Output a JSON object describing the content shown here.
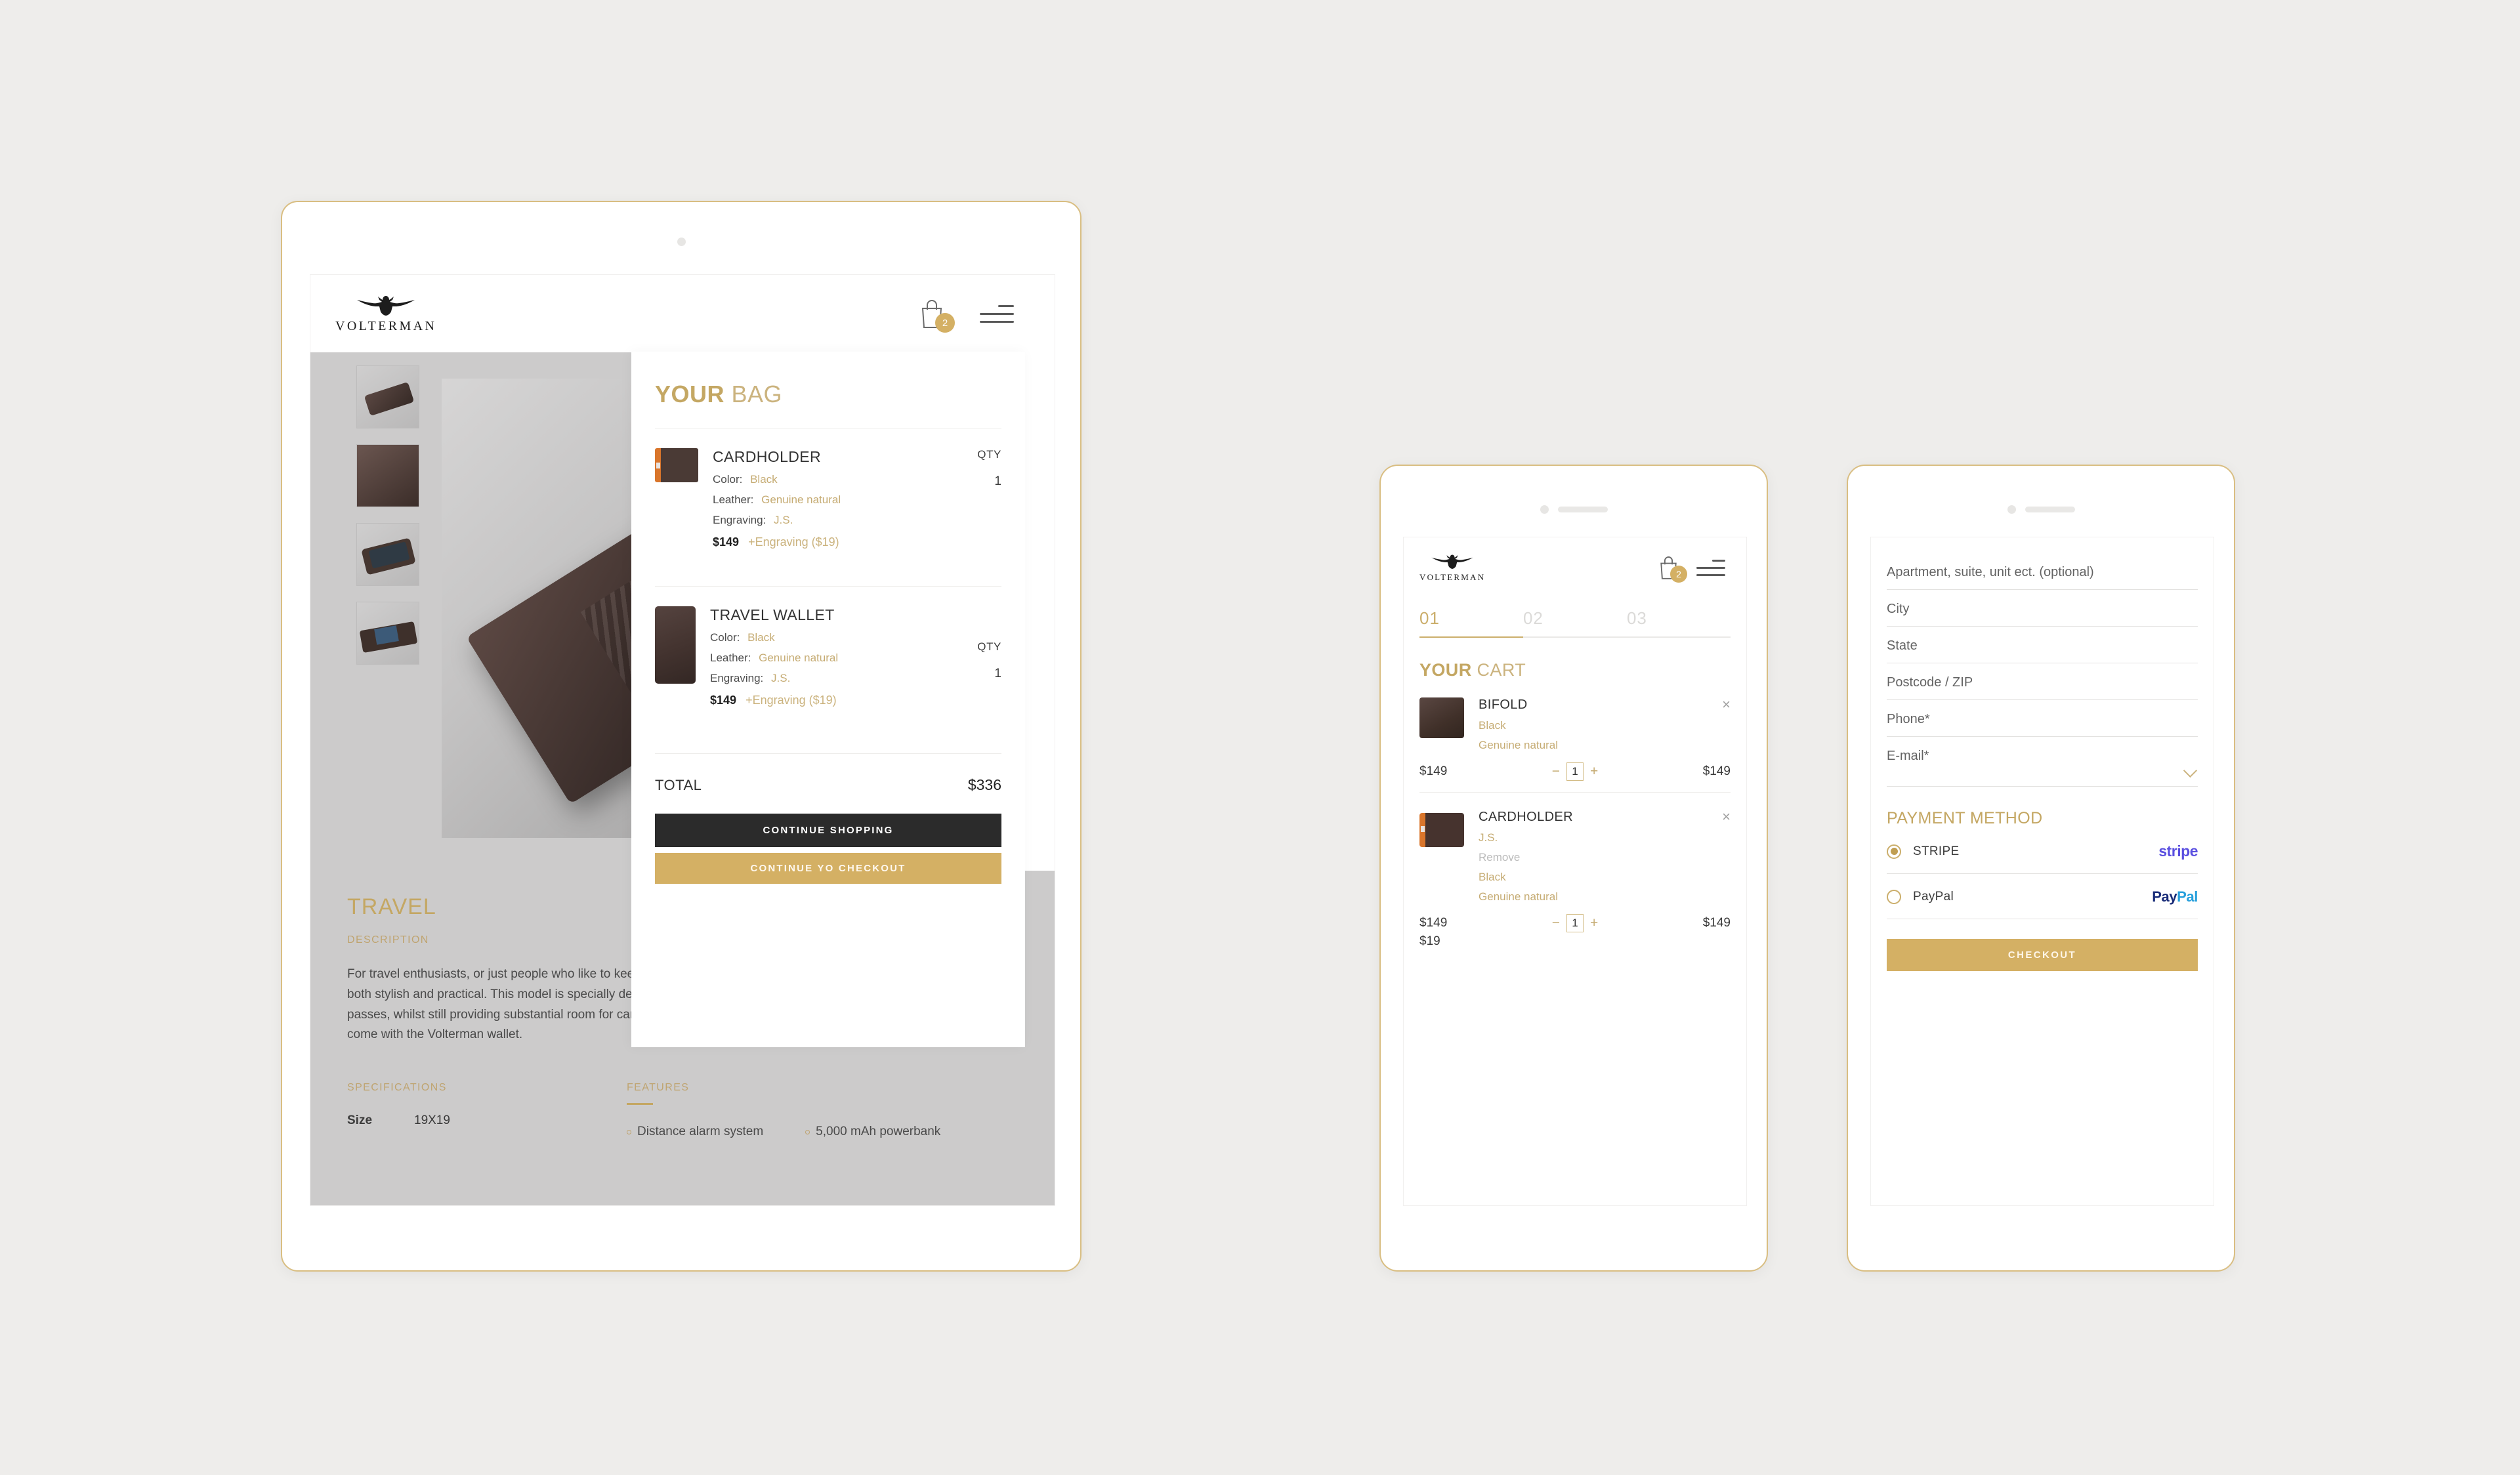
{
  "brand": {
    "name": "VOLTERMAN",
    "bird_icon": "volterman-bird-logo"
  },
  "tablet": {
    "header": {
      "cart_count": "2",
      "cart_icon": "shopping-bag-icon",
      "menu_icon": "hamburger-menu-icon"
    },
    "gallery": {
      "thumbnails": [
        "wallet-closed-thumb",
        "wallet-logo-embossed-thumb",
        "wallet-with-phone-thumb",
        "wallet-open-cards-thumb"
      ],
      "hero_image": "travel-wallet-hero"
    },
    "product": {
      "title": "TRAVEL",
      "description_label": "DESCRIPTION",
      "description": "For travel enthusiasts, or just people who like to keep their documents in a safe place, the Volterman Travel wallet is both stylish and practical. This model is specially designed to store crucial documents such as passports and boarding passes, whilst still providing substantial room for cards and cash. As well as including all of the standard features that come with the Volterman wallet.",
      "specifications_label": "SPECIFICATIONS",
      "features_label": "FEATURES",
      "specs": [
        {
          "name": "Size",
          "value": "19X19"
        }
      ],
      "features": [
        "Distance alarm system",
        "5,000 mAh powerbank"
      ]
    },
    "bag": {
      "title_bold": "YOUR",
      "title_light": "BAG",
      "qty_label": "QTY",
      "items": [
        {
          "name": "CARDHOLDER",
          "image": "cardholder-thumb",
          "attrs": [
            {
              "label": "Color:",
              "value": "Black"
            },
            {
              "label": "Leather:",
              "value": "Genuine natural"
            },
            {
              "label": "Engraving:",
              "value": "J.S."
            }
          ],
          "price": "$149",
          "engraving_price": "+Engraving ($19)",
          "qty": "1"
        },
        {
          "name": "TRAVEL WALLET",
          "image": "travel-wallet-thumb",
          "attrs": [
            {
              "label": "Color:",
              "value": "Black"
            },
            {
              "label": "Leather:",
              "value": "Genuine natural"
            },
            {
              "label": "Engraving:",
              "value": "J.S."
            }
          ],
          "price": "$149",
          "engraving_price": "+Engraving ($19)",
          "qty": "1"
        }
      ],
      "total_label": "TOTAL",
      "total_value": "$336",
      "continue_shopping": "CONTINUE SHOPPING",
      "continue_checkout": "CONTINUE YO CHECKOUT"
    }
  },
  "phone_cart": {
    "header": {
      "cart_count": "2",
      "cart_icon": "shopping-bag-icon",
      "menu_icon": "hamburger-menu-icon"
    },
    "steps": [
      "01",
      "02",
      "03"
    ],
    "active_step": "01",
    "title_bold": "YOUR",
    "title_light": "CART",
    "items": [
      {
        "name": "BIFOLD",
        "image": "bifold-thumb",
        "remove_icon": "close-icon",
        "lines": [
          "Black",
          "Genuine natural"
        ],
        "unit_price": "$149",
        "extra_price": "",
        "qty": "1",
        "minus": "−",
        "plus": "+",
        "line_total": "$149"
      },
      {
        "name": "CARDHOLDER",
        "image": "cardholder-thumb",
        "remove_icon": "close-icon",
        "engraving": "J.S.",
        "remove_label": "Remove",
        "lines": [
          "Black",
          "Genuine natural"
        ],
        "unit_price": "$149",
        "extra_price": "$19",
        "qty": "1",
        "minus": "−",
        "plus": "+",
        "line_total": "$149"
      }
    ]
  },
  "phone_checkout": {
    "fields": [
      {
        "label": "Apartment, suite, unit ect. (optional)",
        "name": "apartment"
      },
      {
        "label": "City",
        "name": "city"
      },
      {
        "label": "State",
        "name": "state"
      },
      {
        "label": "Postcode / ZIP",
        "name": "postcode"
      },
      {
        "label": "Phone*",
        "name": "phone"
      },
      {
        "label": "E-mail*",
        "name": "email",
        "has_chevron": true
      }
    ],
    "payment_title": "PAYMENT METHOD",
    "methods": [
      {
        "name": "STRIPE",
        "selected": true,
        "logo": "stripe"
      },
      {
        "name": "PayPal",
        "selected": false,
        "logo_a": "Pay",
        "logo_b": "Pal"
      }
    ],
    "checkout_label": "CHECKOUT"
  },
  "colors": {
    "gold": "#D4B064",
    "gold_text": "#C4A763",
    "dark_button": "#2B2B2B",
    "background": "#EEEDEB",
    "stripe_purple": "#5A4FE0",
    "paypal_dark": "#1A2D79",
    "paypal_light": "#28A0DC"
  }
}
